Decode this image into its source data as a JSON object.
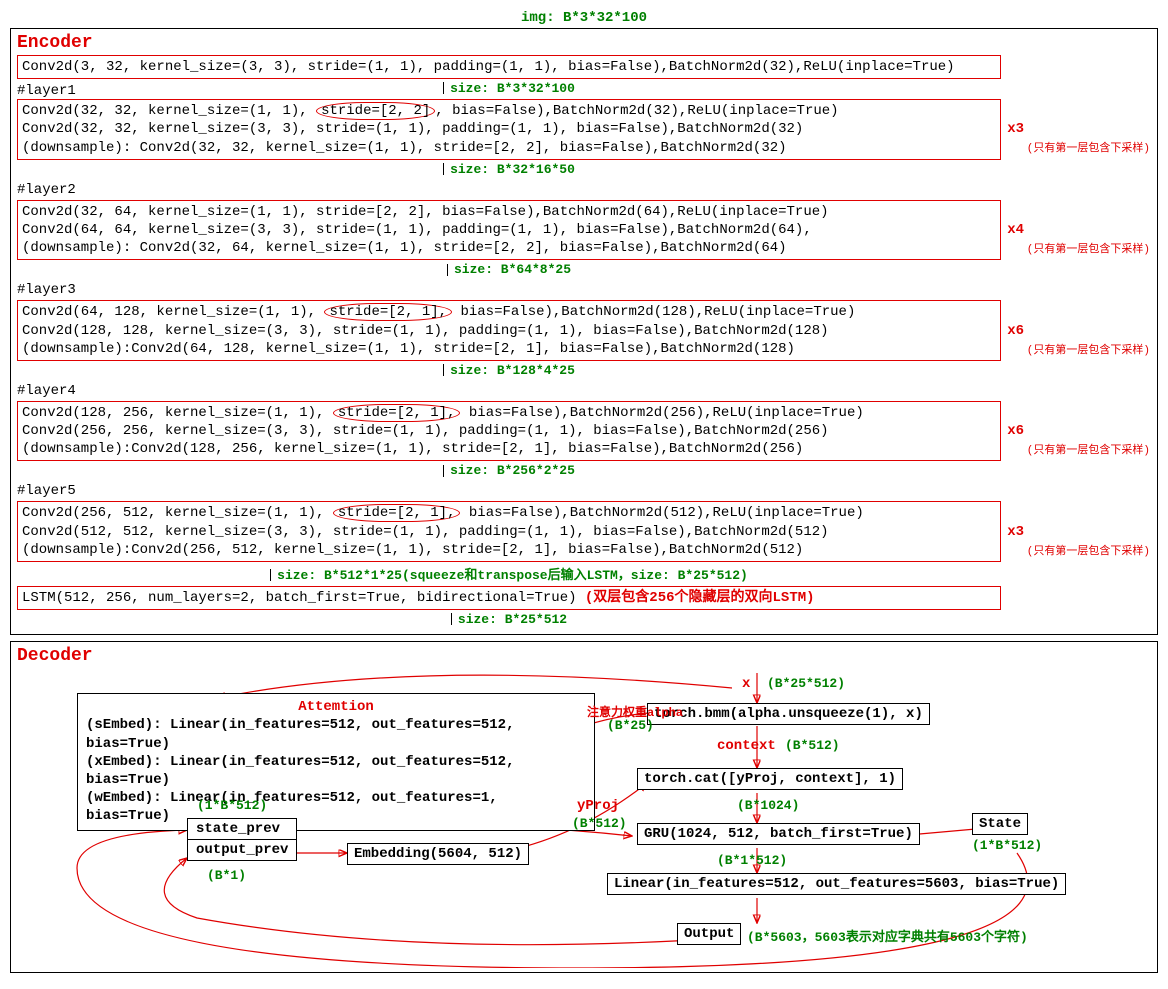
{
  "img_label": "img: B*3*32*100",
  "encoder": {
    "title": "Encoder",
    "conv0": "Conv2d(3, 32, kernel_size=(3, 3), stride=(1, 1), padding=(1, 1), bias=False),BatchNorm2d(32),ReLU(inplace=True)",
    "size0": "size: B*3*32*100",
    "layers": [
      {
        "label": "#layer1",
        "lines": [
          "Conv2d(32, 32, kernel_size=(1, 1), stride=[2, 2], bias=False),BatchNorm2d(32),ReLU(inplace=True)",
          "Conv2d(32, 32, kernel_size=(3, 3), stride=(1, 1), padding=(1, 1), bias=False),BatchNorm2d(32)",
          "(downsample): Conv2d(32, 32, kernel_size=(1, 1), stride=[2, 2], bias=False),BatchNorm2d(32)"
        ],
        "mult": "x3",
        "note": "(只有第一层包含下采样)",
        "circle_stride": "stride=[2, 2]",
        "size_after": "size: B*32*16*50"
      },
      {
        "label": "#layer2",
        "lines": [
          "Conv2d(32, 64, kernel_size=(1, 1), stride=[2, 2], bias=False),BatchNorm2d(64),ReLU(inplace=True)",
          "Conv2d(64, 64, kernel_size=(3, 3), stride=(1, 1), padding=(1, 1), bias=False),BatchNorm2d(64),",
          "(downsample): Conv2d(32, 64, kernel_size=(1, 1), stride=[2, 2], bias=False),BatchNorm2d(64)"
        ],
        "mult": "x4",
        "note": "(只有第一层包含下采样)",
        "size_after": "size: B*64*8*25"
      },
      {
        "label": "#layer3",
        "lines_pre": "Conv2d(64, 128, kernel_size=(1, 1), ",
        "circle_stride": "stride=[2, 1],",
        "lines_post": " bias=False),BatchNorm2d(128),ReLU(inplace=True)",
        "line2": "Conv2d(128, 128, kernel_size=(3, 3), stride=(1, 1), padding=(1, 1), bias=False),BatchNorm2d(128)",
        "line3": "(downsample):Conv2d(64, 128, kernel_size=(1, 1), stride=[2, 1], bias=False),BatchNorm2d(128)",
        "mult": "x6",
        "note": "(只有第一层包含下采样)",
        "size_after": "size: B*128*4*25"
      },
      {
        "label": "#layer4",
        "lines_pre": "Conv2d(128, 256, kernel_size=(1, 1), ",
        "circle_stride": "stride=[2, 1],",
        "lines_post": " bias=False),BatchNorm2d(256),ReLU(inplace=True)",
        "line2": "Conv2d(256, 256, kernel_size=(3, 3), stride=(1, 1), padding=(1, 1), bias=False),BatchNorm2d(256)",
        "line3": "(downsample):Conv2d(128, 256, kernel_size=(1, 1), stride=[2, 1], bias=False),BatchNorm2d(256)",
        "mult": "x6",
        "note": "(只有第一层包含下采样)",
        "size_after": "size: B*256*2*25"
      },
      {
        "label": "#layer5",
        "lines_pre": "Conv2d(256, 512, kernel_size=(1, 1), ",
        "circle_stride": "stride=[2, 1],",
        "lines_post": " bias=False),BatchNorm2d(512),ReLU(inplace=True)",
        "line2": "Conv2d(512, 512, kernel_size=(3, 3), stride=(1, 1), padding=(1, 1), bias=False),BatchNorm2d(512)",
        "line3": "(downsample):Conv2d(256, 512, kernel_size=(1, 1), stride=[2, 1], bias=False),BatchNorm2d(512)",
        "mult": "x3",
        "note": "(只有第一层包含下采样)",
        "size_after": "size: B*512*1*25(squeeze和transpose后输入LSTM，size: B*25*512)"
      }
    ],
    "lstm": "LSTM(512, 256, num_layers=2, batch_first=True, bidirectional=True)",
    "lstm_note": "(双层包含256个隐藏层的双向LSTM)",
    "lstm_size": "size: B*25*512"
  },
  "decoder": {
    "title": "Decoder",
    "attention_title": "Attemtion",
    "attn_lines": [
      "(sEmbed): Linear(in_features=512, out_features=512, bias=True)",
      "(xEmbed): Linear(in_features=512, out_features=512, bias=True)",
      "(wEmbed): Linear(in_features=512, out_features=1,   bias=True)"
    ],
    "alpha_label": "注意力权重alpha",
    "alpha_dim": "(B*25)",
    "x_label": "x",
    "x_dim": "(B*25*512)",
    "bmm": "torch.bmm(alpha.unsqueeze(1), x)",
    "context_label": "context",
    "context_dim": "(B*512)",
    "cat": "torch.cat([yProj, context], 1)",
    "cat_dim": "(B*1024)",
    "gru": "GRU(1024, 512, batch_first=True)",
    "gru_out_dim": "(B*1*512)",
    "linear": "Linear(in_features=512, out_features=5603, bias=True)",
    "output": "Output",
    "output_dim": "(B*5603，5603表示对应字典共有5603个字符)",
    "state": "State",
    "state_dim": "(1*B*512)",
    "state_prev": "state_prev",
    "state_prev_dim": "(1*B*512)",
    "output_prev": "output_prev",
    "output_prev_dim": "(B*1)",
    "embedding": "Embedding(5604, 512)",
    "yproj_label": "yProj",
    "yproj_dim": "(B*512)"
  }
}
